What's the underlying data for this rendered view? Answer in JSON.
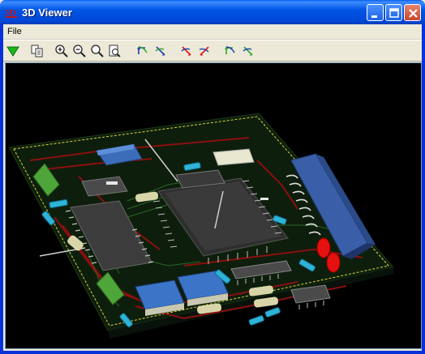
{
  "window": {
    "title": "3D Viewer",
    "icon": "3d-viewer-app-icon"
  },
  "menubar": {
    "items": [
      {
        "label": "File"
      }
    ]
  },
  "toolbar": {
    "tools": [
      {
        "name": "redraw-icon"
      },
      {
        "name": "copy-icon"
      },
      {
        "name": "zoom-in-icon"
      },
      {
        "name": "zoom-out-icon"
      },
      {
        "name": "zoom-fit-icon"
      },
      {
        "name": "zoom-page-icon"
      },
      {
        "name": "rotate-x-neg-icon"
      },
      {
        "name": "rotate-x-pos-icon"
      },
      {
        "name": "rotate-y-neg-icon"
      },
      {
        "name": "rotate-y-pos-icon"
      },
      {
        "name": "rotate-z-neg-icon"
      },
      {
        "name": "rotate-z-pos-icon"
      }
    ]
  },
  "viewport": {
    "content": "pcb-3d-render",
    "background": "#000000",
    "board_color": "#0E1E0C",
    "trace_color": "#8A1010",
    "outline_color": "#D6D640"
  }
}
